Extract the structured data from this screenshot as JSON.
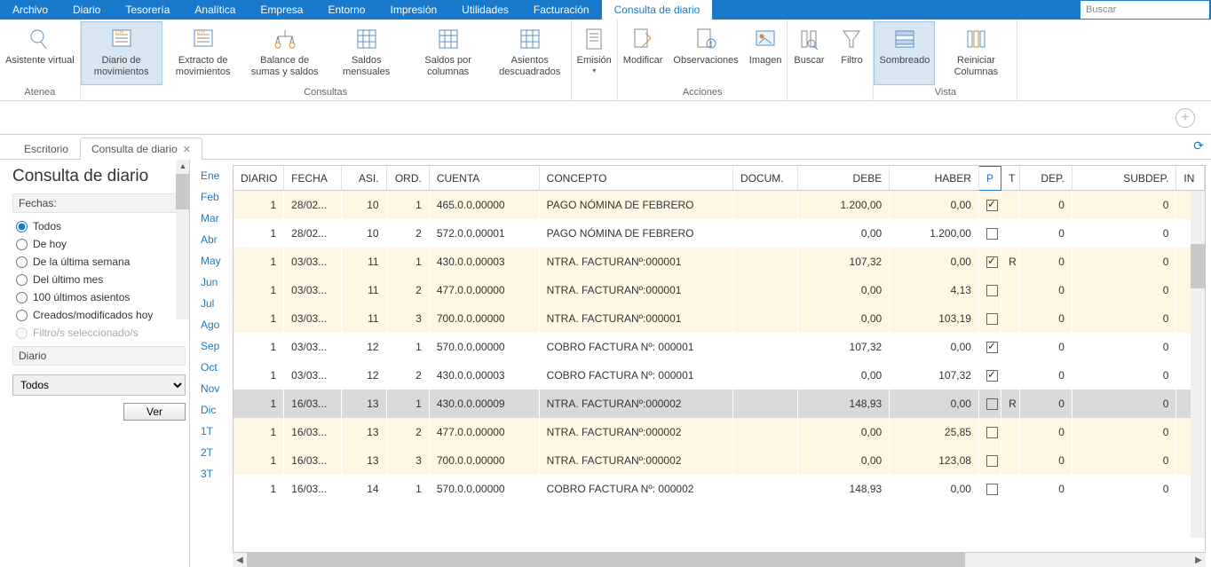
{
  "menu": [
    "Archivo",
    "Diario",
    "Tesorería",
    "Analítica",
    "Empresa",
    "Entorno",
    "Impresión",
    "Utilidades",
    "Facturación",
    "Consulta de diario"
  ],
  "menu_active_index": 9,
  "search_placeholder": "Buscar",
  "ribbon": {
    "groups": [
      {
        "label": "Atenea",
        "items": [
          {
            "key": "asistente",
            "label": "Asistente virtual"
          }
        ]
      },
      {
        "label": "Consultas",
        "items": [
          {
            "key": "diario-mov",
            "label": "Diario de movimientos",
            "active": true
          },
          {
            "key": "extracto",
            "label": "Extracto de movimientos"
          },
          {
            "key": "balance",
            "label": "Balance de sumas y saldos"
          },
          {
            "key": "saldos-men",
            "label": "Saldos mensuales"
          },
          {
            "key": "saldos-col",
            "label": "Saldos por columnas"
          },
          {
            "key": "asientos-desc",
            "label": "Asientos descuadrados"
          }
        ]
      },
      {
        "label": "",
        "items": [
          {
            "key": "emision",
            "label": "Emisión",
            "dropdown": true
          }
        ]
      },
      {
        "label": "Acciones",
        "items": [
          {
            "key": "modificar",
            "label": "Modificar"
          },
          {
            "key": "observaciones",
            "label": "Observaciones"
          },
          {
            "key": "imagen",
            "label": "Imagen"
          }
        ]
      },
      {
        "label": "",
        "items": [
          {
            "key": "buscar",
            "label": "Buscar"
          },
          {
            "key": "filtro",
            "label": "Filtro"
          }
        ]
      },
      {
        "label": "Vista",
        "items": [
          {
            "key": "sombreado",
            "label": "Sombreado",
            "active": true
          },
          {
            "key": "reiniciar-col",
            "label": "Reiniciar Columnas"
          }
        ]
      }
    ]
  },
  "doc_tabs": [
    {
      "label": "Escritorio",
      "active": false,
      "close": false
    },
    {
      "label": "Consulta de diario",
      "active": true,
      "close": true
    }
  ],
  "page_title": "Consulta de diario",
  "sidebar": {
    "fechas_label": "Fechas:",
    "radios": [
      {
        "label": "Todos",
        "checked": true
      },
      {
        "label": "De hoy",
        "checked": false
      },
      {
        "label": "De la última semana",
        "checked": false
      },
      {
        "label": "Del último mes",
        "checked": false
      },
      {
        "label": "100 últimos asientos",
        "checked": false
      },
      {
        "label": "Creados/modificados hoy",
        "checked": false
      },
      {
        "label": "Filtro/s seleccionado/s",
        "checked": false,
        "disabled": true
      }
    ],
    "diario_label": "Diario",
    "diario_value": "Todos",
    "ver_label": "Ver"
  },
  "months": [
    "Ene",
    "Feb",
    "Mar",
    "Abr",
    "May",
    "Jun",
    "Jul",
    "Ago",
    "Sep",
    "Oct",
    "Nov",
    "Dic",
    "1T",
    "2T",
    "3T"
  ],
  "grid": {
    "columns": [
      "DIARIO",
      "FECHA",
      "ASI.",
      "ORD.",
      "CUENTA",
      "CONCEPTO",
      "DOCUM.",
      "DEBE",
      "HABER",
      "P",
      "T",
      "DEP.",
      "SUBDEP.",
      "IN"
    ],
    "rows": [
      {
        "sel": false,
        "y": true,
        "diario": "1",
        "fecha": "28/02...",
        "asi": "10",
        "ord": "1",
        "cuenta": "465.0.0.00000",
        "concepto": "PAGO NÓMINA DE FEBRERO",
        "docum": "",
        "debe": "1.200,00",
        "haber": "0,00",
        "p": true,
        "t": "",
        "dep": "0",
        "subdep": "0"
      },
      {
        "sel": false,
        "y": false,
        "diario": "1",
        "fecha": "28/02...",
        "asi": "10",
        "ord": "2",
        "cuenta": "572.0.0.00001",
        "concepto": "PAGO NÓMINA DE FEBRERO",
        "docum": "",
        "debe": "0,00",
        "haber": "1.200,00",
        "p": false,
        "t": "",
        "dep": "0",
        "subdep": "0"
      },
      {
        "sel": false,
        "y": true,
        "diario": "1",
        "fecha": "03/03...",
        "asi": "11",
        "ord": "1",
        "cuenta": "430.0.0.00003",
        "concepto": "NTRA. FACTURANº:000001",
        "docum": "",
        "debe": "107,32",
        "haber": "0,00",
        "p": true,
        "t": "R",
        "dep": "0",
        "subdep": "0"
      },
      {
        "sel": false,
        "y": true,
        "diario": "1",
        "fecha": "03/03...",
        "asi": "11",
        "ord": "2",
        "cuenta": "477.0.0.00000",
        "concepto": "NTRA. FACTURANº:000001",
        "docum": "",
        "debe": "0,00",
        "haber": "4,13",
        "p": false,
        "t": "",
        "dep": "0",
        "subdep": "0"
      },
      {
        "sel": false,
        "y": true,
        "diario": "1",
        "fecha": "03/03...",
        "asi": "11",
        "ord": "3",
        "cuenta": "700.0.0.00000",
        "concepto": "NTRA. FACTURANº:000001",
        "docum": "",
        "debe": "0,00",
        "haber": "103,19",
        "p": false,
        "t": "",
        "dep": "0",
        "subdep": "0"
      },
      {
        "sel": false,
        "y": false,
        "diario": "1",
        "fecha": "03/03...",
        "asi": "12",
        "ord": "1",
        "cuenta": "570.0.0.00000",
        "concepto": "COBRO FACTURA Nº: 000001",
        "docum": "",
        "debe": "107,32",
        "haber": "0,00",
        "p": true,
        "t": "",
        "dep": "0",
        "subdep": "0"
      },
      {
        "sel": false,
        "y": false,
        "diario": "1",
        "fecha": "03/03...",
        "asi": "12",
        "ord": "2",
        "cuenta": "430.0.0.00003",
        "concepto": "COBRO FACTURA Nº: 000001",
        "docum": "",
        "debe": "0,00",
        "haber": "107,32",
        "p": true,
        "t": "",
        "dep": "0",
        "subdep": "0"
      },
      {
        "sel": true,
        "y": false,
        "diario": "1",
        "fecha": "16/03...",
        "asi": "13",
        "ord": "1",
        "cuenta": "430.0.0.00009",
        "concepto": "NTRA. FACTURANº:000002",
        "docum": "",
        "debe": "148,93",
        "haber": "0,00",
        "p": false,
        "t": "R",
        "dep": "0",
        "subdep": "0"
      },
      {
        "sel": false,
        "y": true,
        "diario": "1",
        "fecha": "16/03...",
        "asi": "13",
        "ord": "2",
        "cuenta": "477.0.0.00000",
        "concepto": "NTRA. FACTURANº:000002",
        "docum": "",
        "debe": "0,00",
        "haber": "25,85",
        "p": false,
        "t": "",
        "dep": "0",
        "subdep": "0"
      },
      {
        "sel": false,
        "y": true,
        "diario": "1",
        "fecha": "16/03...",
        "asi": "13",
        "ord": "3",
        "cuenta": "700.0.0.00000",
        "concepto": "NTRA. FACTURANº:000002",
        "docum": "",
        "debe": "0,00",
        "haber": "123,08",
        "p": false,
        "t": "",
        "dep": "0",
        "subdep": "0"
      },
      {
        "sel": false,
        "y": false,
        "diario": "1",
        "fecha": "16/03...",
        "asi": "14",
        "ord": "1",
        "cuenta": "570.0.0.00000",
        "concepto": "COBRO FACTURA Nº: 000002",
        "docum": "",
        "debe": "148,93",
        "haber": "0,00",
        "p": false,
        "t": "",
        "dep": "0",
        "subdep": "0"
      }
    ]
  }
}
